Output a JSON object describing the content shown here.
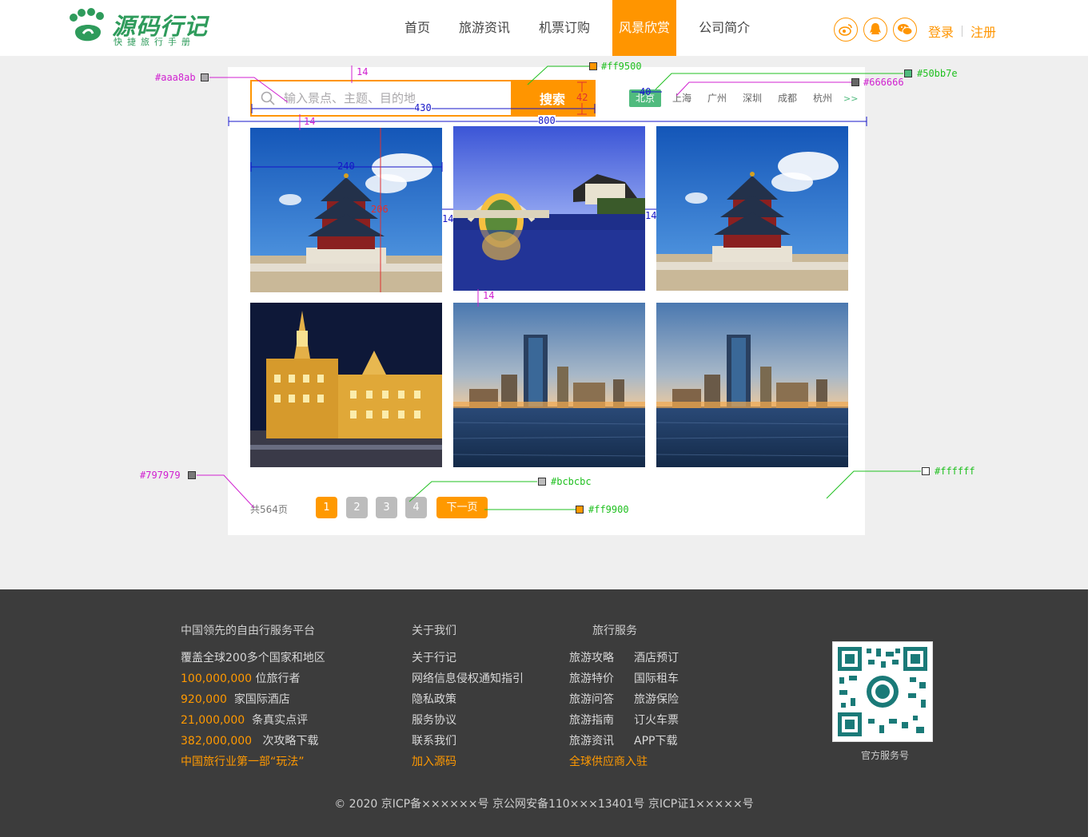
{
  "logo": {
    "title": "源码行记",
    "subtitle": "快捷旅行手册"
  },
  "nav": {
    "items": [
      "首页",
      "旅游资讯",
      "机票订购",
      "风景欣赏",
      "公司简介"
    ],
    "active_index": 3
  },
  "social": {
    "icons": [
      "weibo-icon",
      "qq-icon",
      "wechat-icon"
    ]
  },
  "auth": {
    "login": "登录",
    "register": "注册"
  },
  "search": {
    "placeholder": "输入景点、主题、目的地",
    "button": "搜索"
  },
  "cities": {
    "items": [
      "北京",
      "上海",
      "广州",
      "深圳",
      "成都",
      "杭州"
    ],
    "active_index": 0,
    "more": ">>"
  },
  "gallery": {
    "photos": [
      "temple-of-heaven",
      "arch-bridge-night",
      "temple-of-heaven",
      "bund-night",
      "city-skyline",
      "city-skyline"
    ]
  },
  "pager": {
    "total": "共564页",
    "pages": [
      "1",
      "2",
      "3",
      "4"
    ],
    "active_index": 0,
    "next": "下一页"
  },
  "annotations": {
    "c_aaa8ab": "#aaa8ab",
    "c_ff9500": "#ff9500",
    "c_666666": "#666666",
    "c_50bb7e": "#50bb7e",
    "c_797979": "#797979",
    "c_bcbcbc": "#bcbcbc",
    "c_ff9900": "#ff9900",
    "c_ffffff": "#ffffff",
    "m14": "14",
    "m42": "42",
    "m430": "430",
    "m800": "800",
    "m240": "240",
    "m206": "206",
    "m40": "40"
  },
  "footer": {
    "col1": {
      "head": "中国领先的自由行服务平台",
      "intro": "覆盖全球200多个国家和地区",
      "stats": [
        {
          "num": "100,000,000",
          "label": "位旅行者"
        },
        {
          "num": "920,000",
          "label": "家国际酒店"
        },
        {
          "num": "21,000,000",
          "label": "条真实点评"
        },
        {
          "num": "382,000,000",
          "label": "次攻略下载"
        }
      ],
      "highlight": "中国旅行业第一部“玩法”"
    },
    "col2": {
      "head": "关于我们",
      "links": [
        "关于行记",
        "网络信息侵权通知指引",
        "隐私政策",
        "服务协议",
        "联系我们"
      ],
      "highlight": "加入源码"
    },
    "col3": {
      "head": "旅行服务",
      "links_a": [
        "旅游攻略",
        "旅游特价",
        "旅游问答",
        "旅游指南",
        "旅游资讯"
      ],
      "links_b": [
        "酒店预订",
        "国际租车",
        "旅游保险",
        "订火车票",
        "APP下载"
      ],
      "highlight": "全球供应商入驻"
    },
    "qr_label": "官方服务号",
    "copyright": "© 2020 京ICP备××××××号 京公网安备110×××13401号 京ICP证1×××××号"
  }
}
